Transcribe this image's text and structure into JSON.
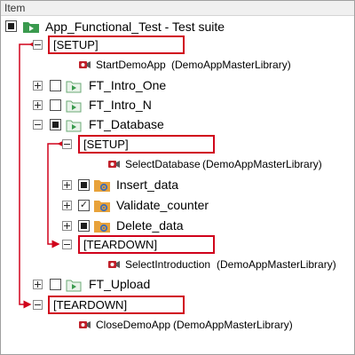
{
  "header": {
    "column_label": "Item"
  },
  "suite": {
    "name": "App_Functional_Test - Test suite"
  },
  "rows": {
    "setup_root": "[SETUP]",
    "start_demo_name": "StartDemoApp",
    "start_demo_lib": "(DemoAppMasterLibrary)",
    "ft_intro_one": "FT_Intro_One",
    "ft_intro_n": "FT_Intro_N",
    "ft_database": "FT_Database",
    "setup_db": "[SETUP]",
    "select_db_name": "SelectDatabase",
    "select_db_lib": "(DemoAppMasterLibrary)",
    "insert_data": "Insert_data",
    "validate_counter": "Validate_counter",
    "delete_data": "Delete_data",
    "teardown_db": "[TEARDOWN]",
    "select_intro_name": "SelectIntroduction",
    "select_intro_lib": "(DemoAppMasterLibrary)",
    "ft_upload": "FT_Upload",
    "teardown_root": "[TEARDOWN]",
    "close_demo_name": "CloseDemoApp",
    "close_demo_lib": "(DemoAppMasterLibrary)"
  },
  "colors": {
    "annotation_red": "#d0021b",
    "suite_green": "#3a9a4e",
    "keyword_orange": "#e8a23a",
    "record_red": "#c0202a"
  },
  "icons": {
    "suite": "green-folder-play-icon",
    "test": "test-case-play-icon",
    "keyword": "folder-gear-icon",
    "library_keyword": "record-camera-icon"
  }
}
